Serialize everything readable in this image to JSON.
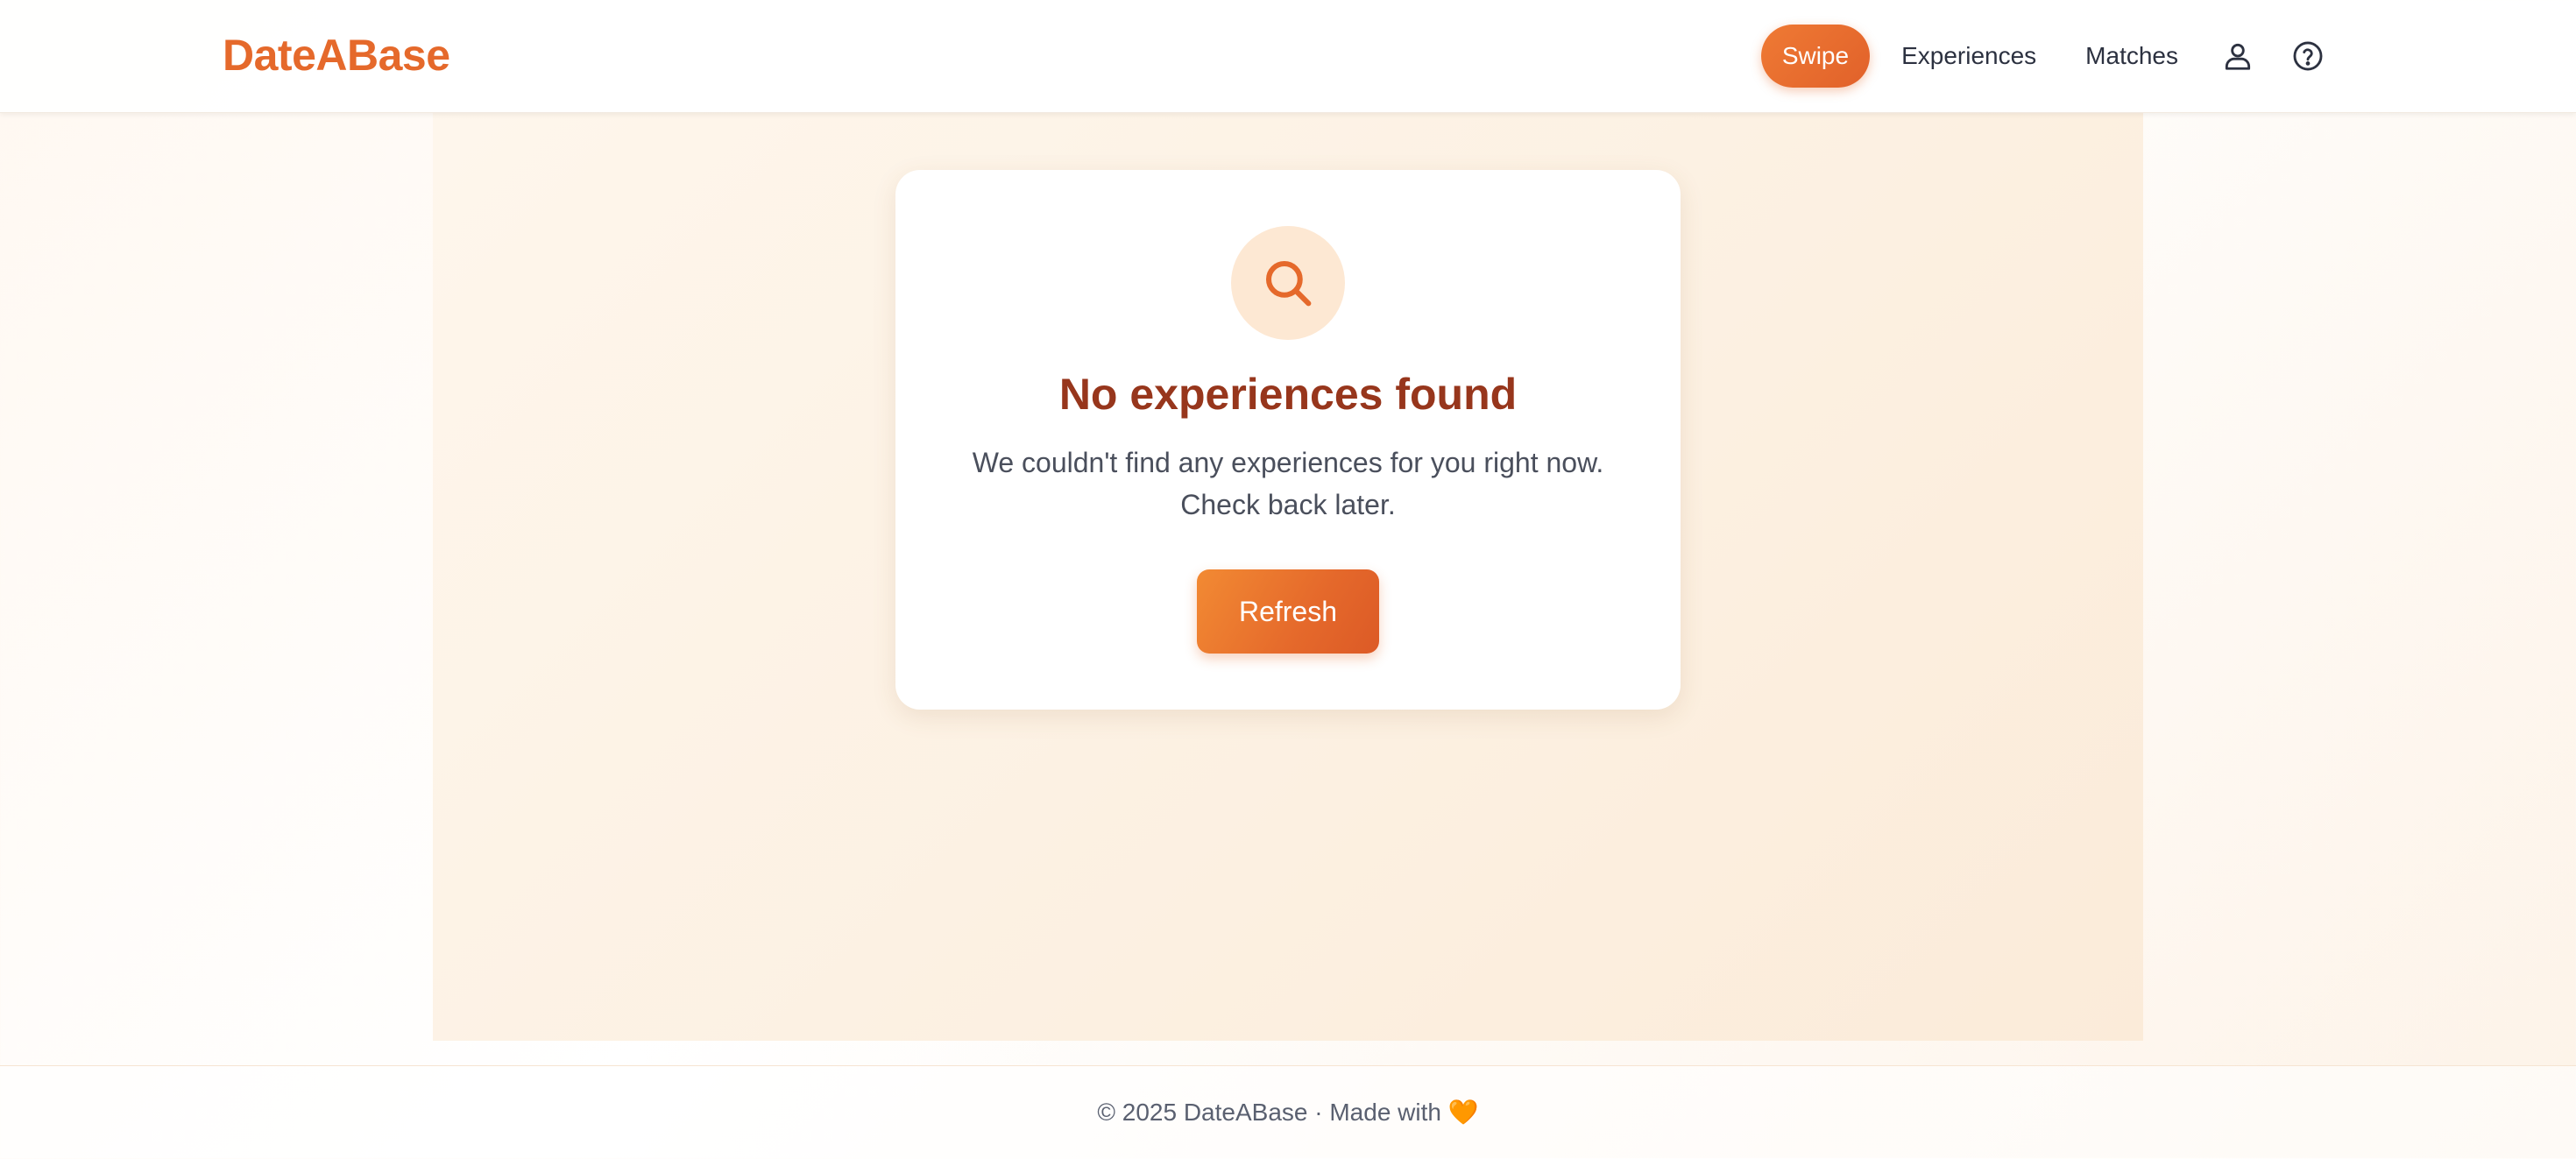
{
  "app": {
    "name": "DateABase",
    "accent_color": "#e5692b"
  },
  "nav": {
    "items": [
      {
        "label": "Swipe",
        "active": true
      },
      {
        "label": "Experiences",
        "active": false
      },
      {
        "label": "Matches",
        "active": false
      }
    ],
    "icons": [
      "user-icon",
      "help-icon"
    ]
  },
  "empty_state": {
    "icon": "search-icon",
    "title": "No experiences found",
    "message_line1": "We couldn't find any experiences for you right now.",
    "message_line2": "Check back later.",
    "button_label": "Refresh"
  },
  "footer": {
    "text": "© 2025 DateABase · Made with",
    "heart": "🧡"
  }
}
